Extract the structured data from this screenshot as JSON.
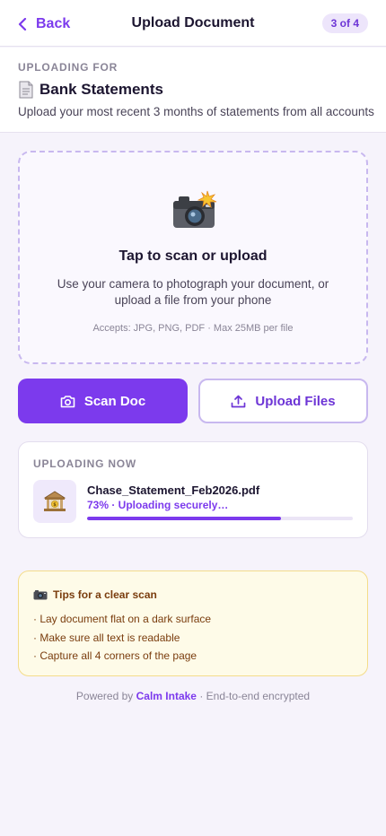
{
  "header": {
    "back_label": "Back",
    "title": "Upload Document",
    "step_badge": "3 of 4"
  },
  "uploading_for": {
    "label": "UPLOADING FOR",
    "title": "Bank Statements",
    "description": "Upload your most recent 3 months of statements from all accounts"
  },
  "dropzone": {
    "title": "Tap to scan or upload",
    "description": "Use your camera to photograph your document, or upload a file from your phone",
    "accepts": "Accepts: JPG, PNG, PDF · Max 25MB per file"
  },
  "actions": {
    "scan_label": "Scan Doc",
    "upload_label": "Upload Files"
  },
  "uploading_now": {
    "label": "UPLOADING NOW",
    "file_name": "Chase_Statement_Feb2026.pdf",
    "status": "73% · Uploading securely…",
    "progress_percent": 73
  },
  "tips": {
    "title": "Tips for a clear scan",
    "items": [
      "· Lay document flat on a dark surface",
      "· Make sure all text is readable",
      "· Capture all 4 corners of the page"
    ]
  },
  "footer": {
    "prefix": "Powered by",
    "brand": "Calm Intake",
    "suffix": "· End-to-end encrypted"
  },
  "colors": {
    "accent": "#7c3aed",
    "background": "#f6f3fb",
    "tips_background": "#fefbe8",
    "tips_text": "#7a3d0e"
  },
  "icons": {
    "back": "chevron-left-icon",
    "document": "document-icon",
    "camera_flash": "camera-flash-icon",
    "scan": "camera-icon",
    "upload": "upload-icon",
    "bank": "bank-icon",
    "tips_camera": "camera-icon"
  }
}
